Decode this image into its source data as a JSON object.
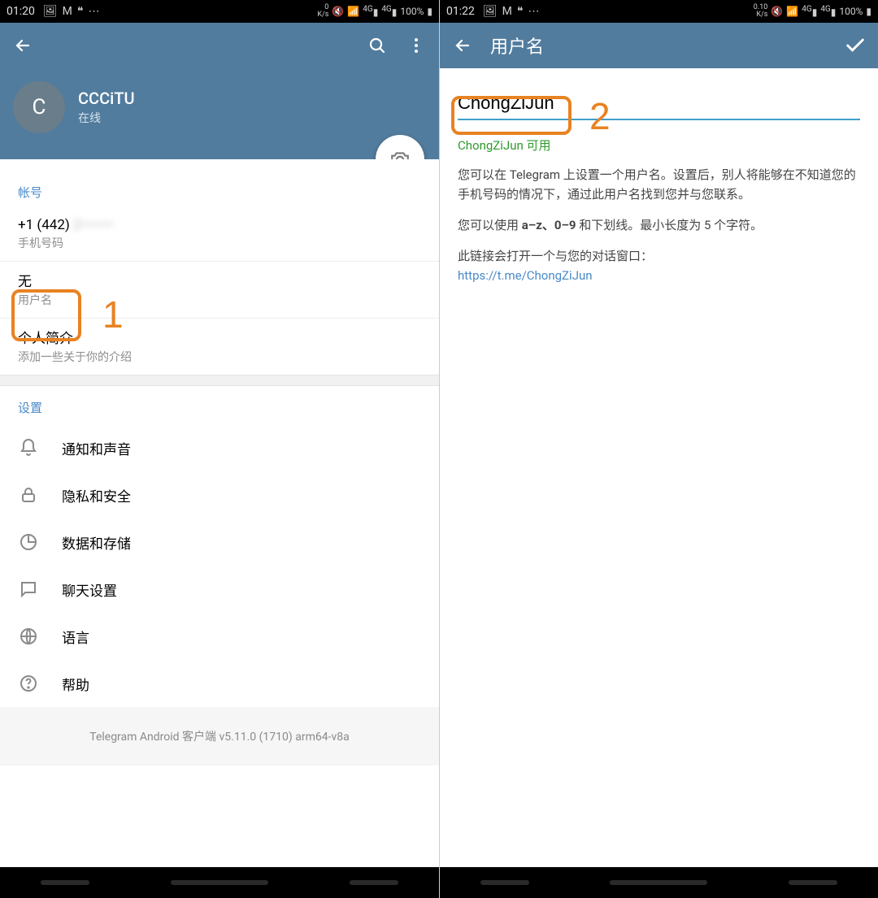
{
  "colors": {
    "brand": "#527c9e",
    "accent": "#4a8ac9",
    "highlight": "#e88222",
    "success": "#2e9a2e",
    "link": "#4a8ac9"
  },
  "annotations": {
    "one": "1",
    "two": "2"
  },
  "left": {
    "status": {
      "time": "01:20",
      "ks_top": "0",
      "ks_bot": "K/s",
      "sig": "4G",
      "batt": "100%"
    },
    "profile": {
      "avatar_letter": "C",
      "name": "CCCiTU",
      "status": "在线"
    },
    "account": {
      "header": "帐号",
      "phone_value": "+1 (442)",
      "phone_hidden": "2•••••••",
      "phone_label": "手机号码",
      "username_value": "无",
      "username_label": "用户名",
      "bio_value": "个人简介",
      "bio_label": "添加一些关于你的介绍"
    },
    "settings": {
      "header": "设置",
      "items": [
        {
          "label": "通知和声音"
        },
        {
          "label": "隐私和安全"
        },
        {
          "label": "数据和存储"
        },
        {
          "label": "聊天设置"
        },
        {
          "label": "语言"
        },
        {
          "label": "帮助"
        }
      ]
    },
    "footer": "Telegram Android 客户端 v5.11.0 (1710) arm64-v8a"
  },
  "right": {
    "status": {
      "time": "01:22",
      "ks_top": "0.10",
      "ks_bot": "K/s",
      "sig": "4G",
      "batt": "100%"
    },
    "title": "用户名",
    "input_value": "ChongZiJun",
    "available_msg": "ChongZiJun 可用",
    "desc1": "您可以在 Telegram 上设置一个用户名。设置后，别人将能够在不知道您的手机号码的情况下，通过此用户名找到您并与您联系。",
    "desc2_a": "您可以使用 ",
    "desc2_b": "a–z、0–9",
    "desc2_c": " 和下划线。最小长度为 5 个字符。",
    "desc3": "此链接会打开一个与您的对话窗口：",
    "link": "https://t.me/ChongZiJun"
  }
}
